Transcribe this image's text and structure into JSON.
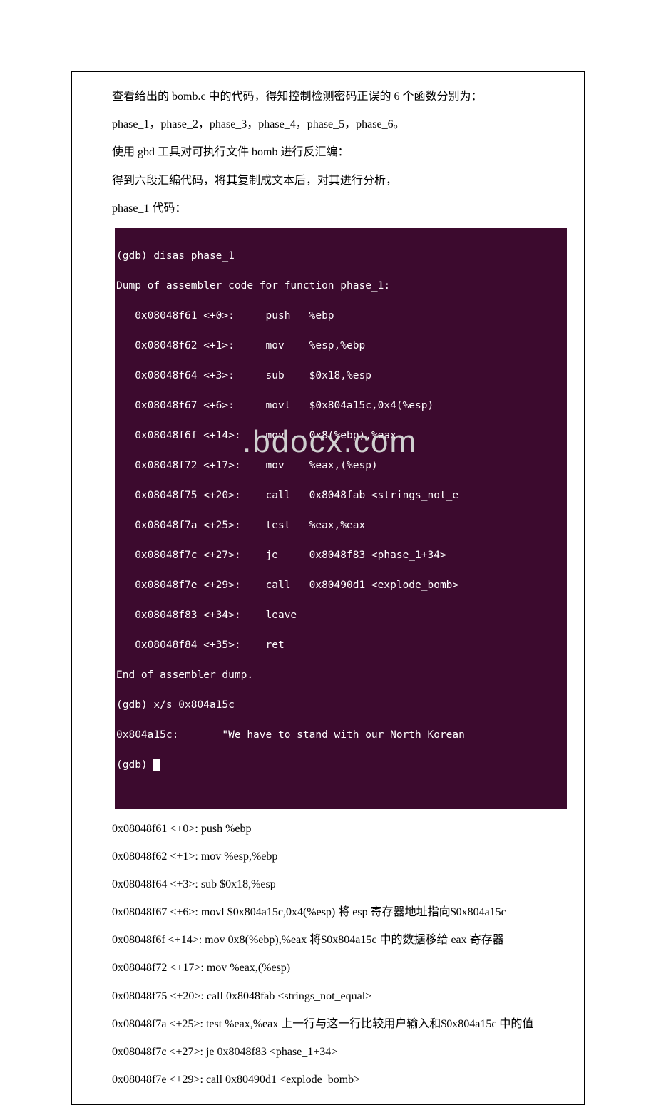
{
  "watermark": ".bdocx.com",
  "paragraphs": {
    "intro": "查看给出的 bomb.c 中的代码，得知控制检测密码正误的 6 个函数分别为：",
    "phases_list": "phase_1，phase_2，phase_3，phase_4，phase_5，phase_6。",
    "use_gdb": "使用 gbd 工具对可执行文件 bomb 进行反汇编：",
    "six_segments": "得到六段汇编代码，将其复制成文本后，对其进行分析，",
    "phase1_code_label": "phase_1 代码："
  },
  "terminal": {
    "l0": "(gdb) disas phase_1",
    "l1": "Dump of assembler code for function phase_1:",
    "l2": "   0x08048f61 <+0>:     push   %ebp",
    "l3": "   0x08048f62 <+1>:     mov    %esp,%ebp",
    "l4": "   0x08048f64 <+3>:     sub    $0x18,%esp",
    "l5": "   0x08048f67 <+6>:     movl   $0x804a15c,0x4(%esp)",
    "l6": "   0x08048f6f <+14>:    mov    0x8(%ebp),%eax",
    "l7": "   0x08048f72 <+17>:    mov    %eax,(%esp)",
    "l8": "   0x08048f75 <+20>:    call   0x8048fab <strings_not_e",
    "l9": "   0x08048f7a <+25>:    test   %eax,%eax",
    "l10": "   0x08048f7c <+27>:    je     0x8048f83 <phase_1+34>",
    "l11": "   0x08048f7e <+29>:    call   0x80490d1 <explode_bomb>",
    "l12": "   0x08048f83 <+34>:    leave",
    "l13": "   0x08048f84 <+35>:    ret",
    "l14": "End of assembler dump.",
    "l15": "(gdb) x/s 0x804a15c",
    "l16": "0x804a15c:       \"We have to stand with our North Korean",
    "l17": "(gdb) "
  },
  "analysis": {
    "a1": "0x08048f61 <+0>: push %ebp",
    "a2": "0x08048f62 <+1>: mov %esp,%ebp",
    "a3": "0x08048f64 <+3>: sub $0x18,%esp",
    "a4": "0x08048f67 <+6>: movl $0x804a15c,0x4(%esp)  将 esp 寄存器地址指向$0x804a15c",
    "a5": "0x08048f6f <+14>: mov 0x8(%ebp),%eax 将$0x804a15c 中的数据移给 eax 寄存器",
    "a6": "0x08048f72 <+17>: mov %eax,(%esp)",
    "a7": "0x08048f75 <+20>: call 0x8048fab <strings_not_equal>",
    "a8": "0x08048f7a <+25>: test %eax,%eax 上一行与这一行比较用户输入和$0x804a15c 中的值",
    "a9": "0x08048f7c <+27>: je 0x8048f83 <phase_1+34>",
    "a10": "0x08048f7e <+29>: call 0x80490d1 <explode_bomb>"
  }
}
